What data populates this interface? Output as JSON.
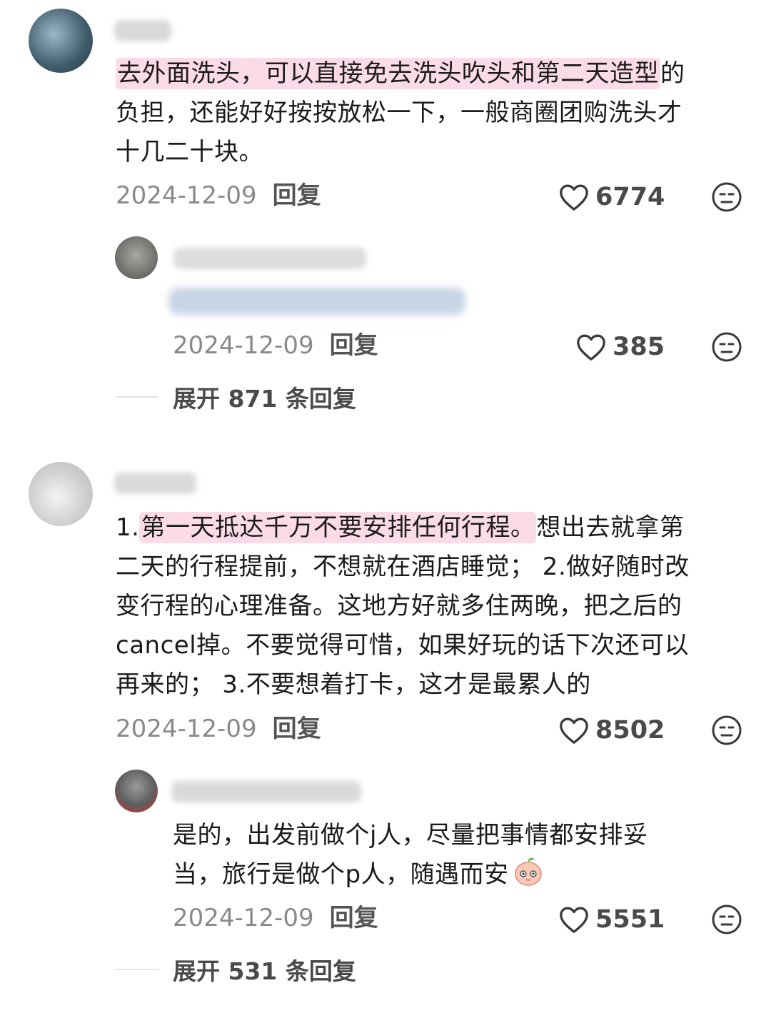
{
  "comments": [
    {
      "text_lines": {
        "l1_highlight": "去外面洗头，可以直接免去洗头吹头和第二天造型",
        "l1_rest": "的",
        "l2": "负担，还能好好按按放松一下，一般商圈团购洗头才",
        "l3": "十几二十块。"
      },
      "date": "2024-12-09",
      "reply_label": "回复",
      "likes": "6774",
      "reply": {
        "date": "2024-12-09",
        "reply_label": "回复",
        "likes": "385"
      },
      "expand_label": "展开 871 条回复"
    },
    {
      "text_lines": {
        "l1_prefix": "1.",
        "l1_highlight": "第一天抵达千万不要安排任何行程。",
        "l1_rest": "想出去就拿第",
        "l2": "二天的行程提前，不想就在酒店睡觉； 2.做好随时改",
        "l3": "变行程的心理准备。这地方好就多住两晚，把之后的",
        "l4": "cancel掉。不要觉得可惜，如果好玩的话下次还可以",
        "l5": "再来的； 3.不要想着打卡，这才是最累人的"
      },
      "date": "2024-12-09",
      "reply_label": "回复",
      "likes": "8502",
      "reply": {
        "text_l1": "是的，出发前做个j人，尽量把事情都安排妥",
        "text_l2": "当，旅行是做个p人，随遇而安",
        "date": "2024-12-09",
        "reply_label": "回复",
        "likes": "5551"
      },
      "expand_label": "展开 531 条回复"
    }
  ],
  "icons": {
    "heart": "heart-icon",
    "face": "neutral-face-icon",
    "emoji": "peach-emoji-icon"
  },
  "colors": {
    "highlight": "#fbdbe7",
    "meta": "#8a8a8a"
  }
}
